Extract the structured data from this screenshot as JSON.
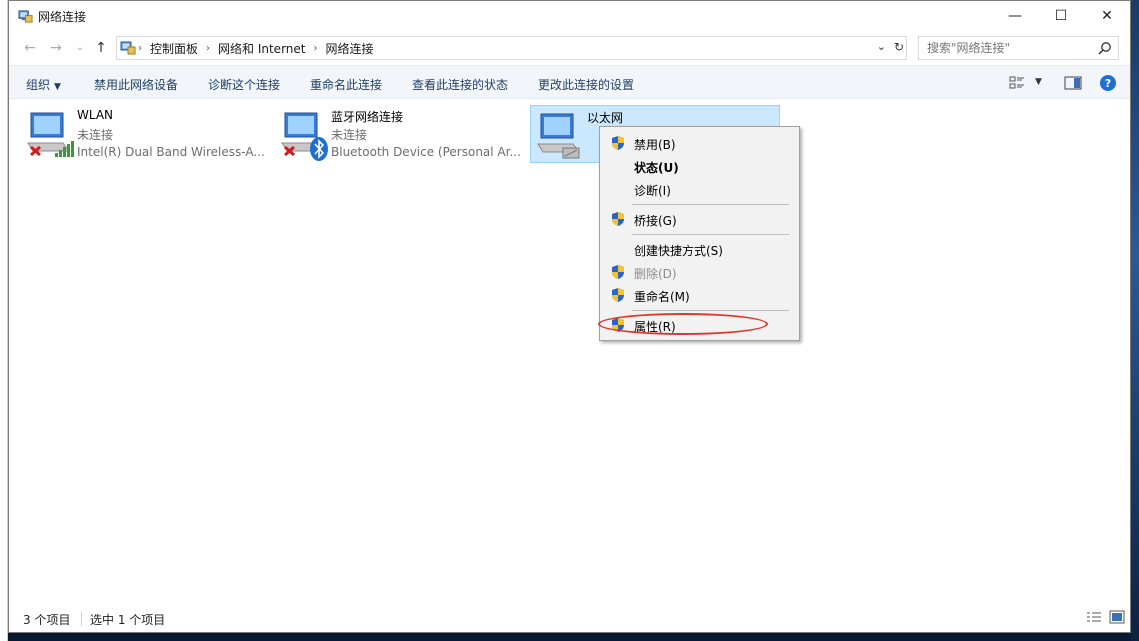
{
  "window": {
    "title": "网络连接",
    "controls": {
      "minimize": "—",
      "maximize": "☐",
      "close": "✕"
    }
  },
  "address": {
    "back": "←",
    "forward": "→",
    "recent": "⌄",
    "up": "↑",
    "breadcrumbs": [
      "控制面板",
      "网络和 Internet",
      "网络连接"
    ],
    "dropdown": "⌄",
    "refresh": "↻"
  },
  "search": {
    "placeholder": "搜索\"网络连接\""
  },
  "commandbar": {
    "organize": "组织",
    "disable": "禁用此网络设备",
    "diagnose": "诊断这个连接",
    "rename": "重命名此连接",
    "view_status": "查看此连接的状态",
    "change_settings": "更改此连接的设置",
    "help": "?"
  },
  "connections": [
    {
      "name": "WLAN",
      "status": "未连接",
      "device": "Intel(R) Dual Band Wireless-A...",
      "icon": "wifi-adapter-icon"
    },
    {
      "name": "蓝牙网络连接",
      "status": "未连接",
      "device": "Bluetooth Device (Personal Ar...",
      "icon": "bluetooth-adapter-icon"
    },
    {
      "name": "以太网",
      "status": "",
      "device": "",
      "icon": "ethernet-adapter-icon",
      "selected": true
    }
  ],
  "context_menu": {
    "items": [
      {
        "label": "禁用(B)",
        "shield": true
      },
      {
        "label": "状态(U)",
        "bold": true
      },
      {
        "label": "诊断(I)"
      },
      {
        "label": "桥接(G)",
        "shield": true
      },
      {
        "label": "创建快捷方式(S)"
      },
      {
        "label": "删除(D)",
        "shield": true,
        "disabled": true
      },
      {
        "label": "重命名(M)",
        "shield": true
      },
      {
        "label": "属性(R)",
        "shield": true,
        "highlighted": true
      }
    ]
  },
  "statusbar": {
    "count": "3 个项目",
    "selection": "选中 1 个项目"
  },
  "colors": {
    "accent": "#0078d7",
    "selection": "#cce8ff",
    "annotation": "#e0342c"
  }
}
